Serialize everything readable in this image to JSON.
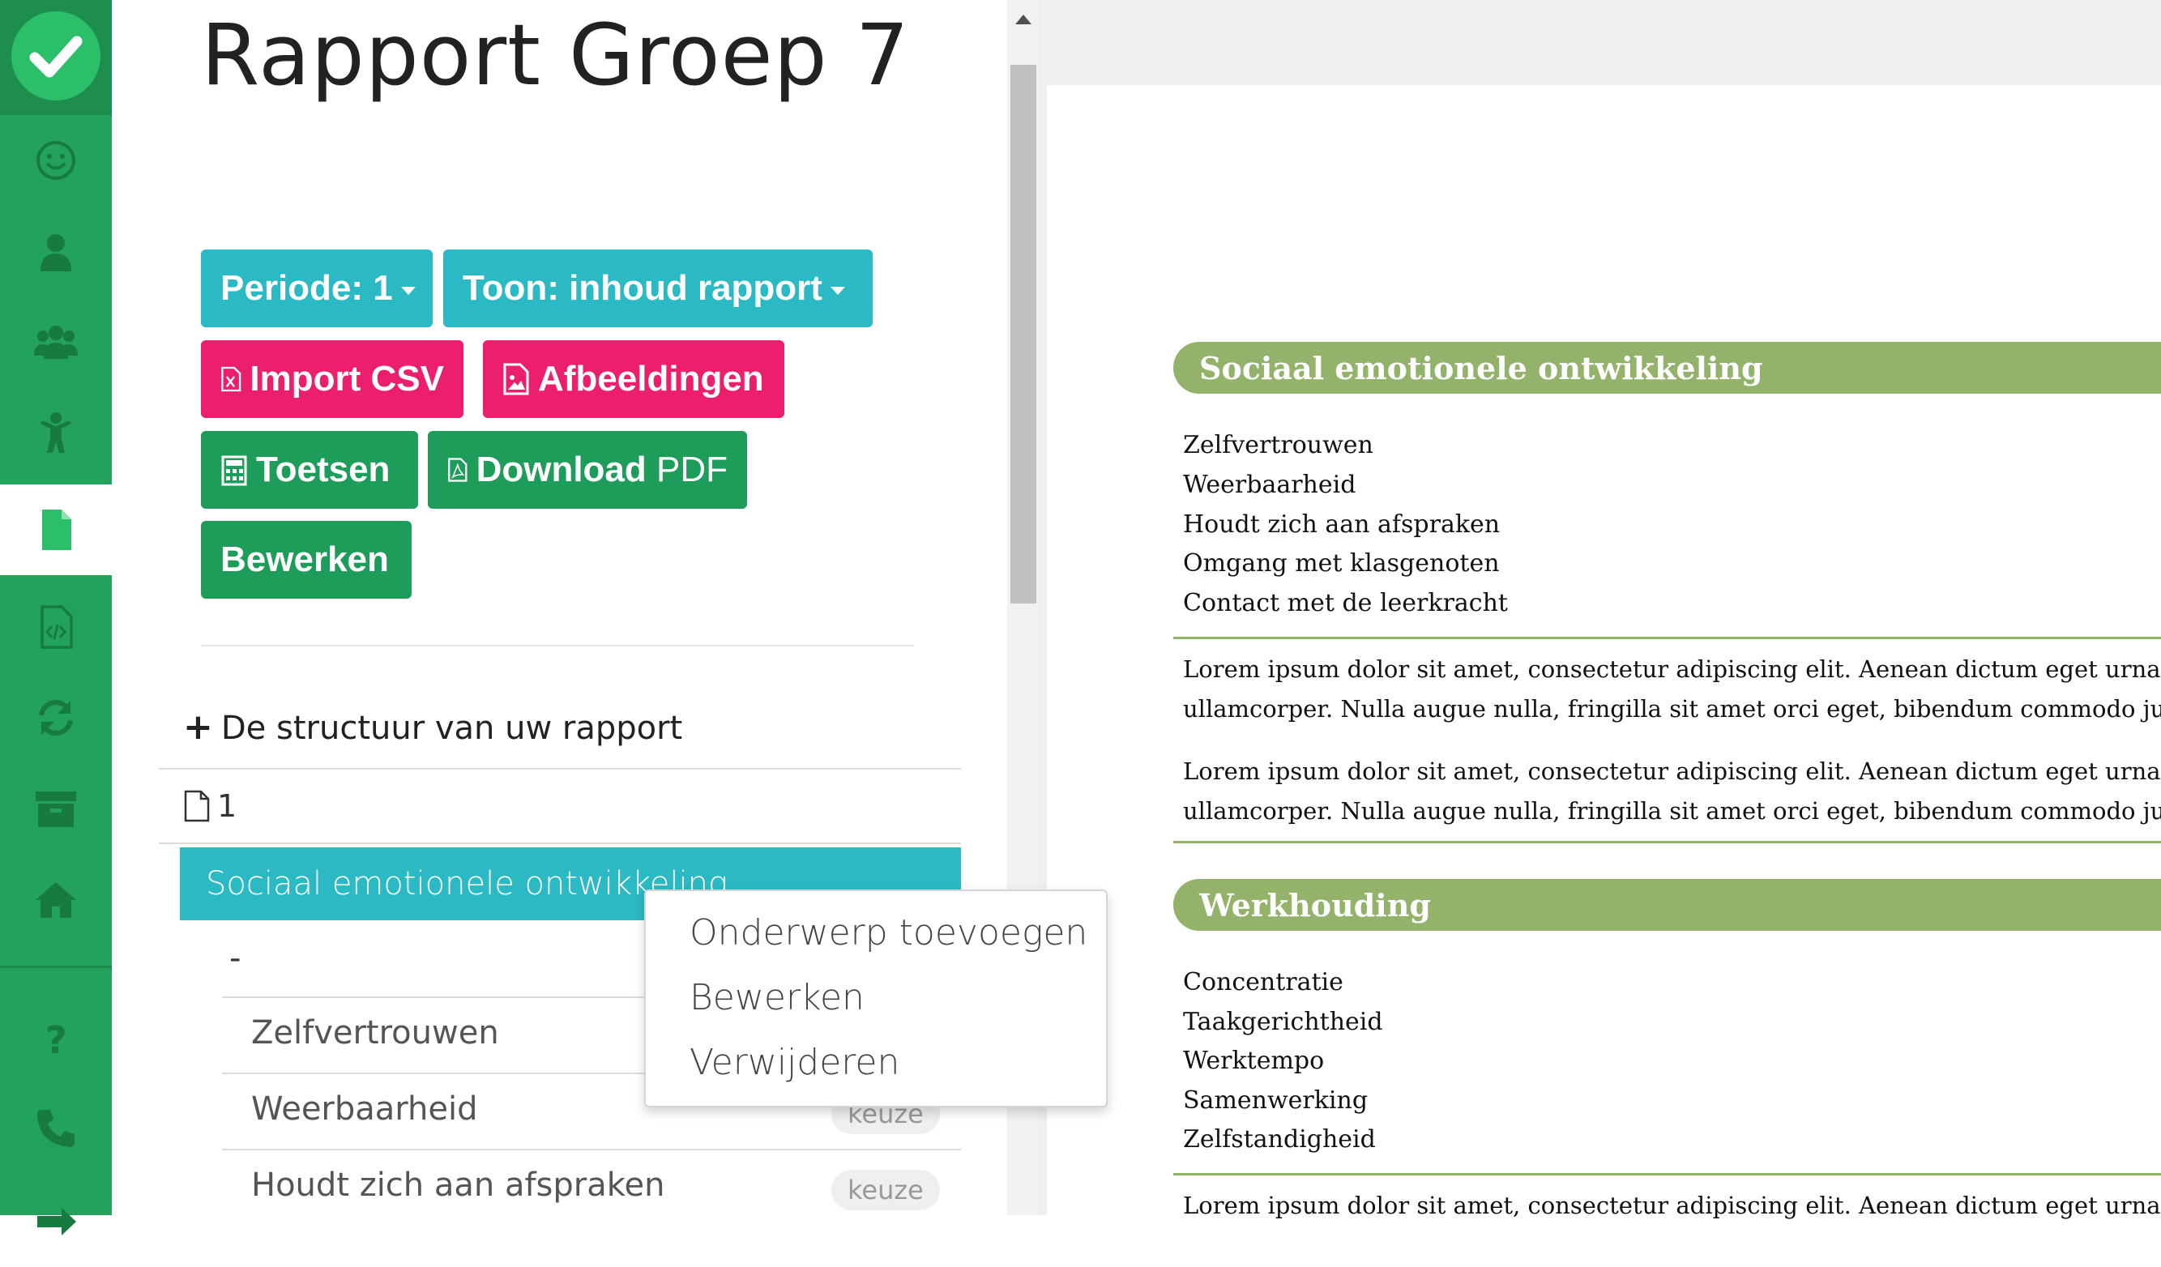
{
  "title": "Rapport Groep 7",
  "buttons": {
    "periode": "Periode: 1",
    "toon": "Toon: inhoud rapport",
    "import_csv": "Import CSV",
    "afbeeldingen": "Afbeeldingen",
    "toetsen": "Toetsen",
    "download_main": "Download",
    "download_suffix": "PDF",
    "bewerken": "Bewerken"
  },
  "structure": {
    "header": "De structuur van uw rapport",
    "page_label": "1",
    "section": "Sociaal emotionele ontwikkeling",
    "dash": "-",
    "items": [
      {
        "label": "Zelfvertrouwen",
        "badge": ""
      },
      {
        "label": "Weerbaarheid",
        "badge": "keuze"
      },
      {
        "label": "Houdt zich aan afspraken",
        "badge": "keuze"
      }
    ]
  },
  "context_menu": [
    "Onderwerp toevoegen",
    "Bewerken",
    "Verwijderen"
  ],
  "sidebar": {
    "icons": [
      "smile-icon",
      "user-icon",
      "group-icon",
      "child-icon",
      "report-icon",
      "code-file-icon",
      "refresh-icon",
      "archive-icon",
      "home-icon",
      "help-icon",
      "phone-icon",
      "logout-icon"
    ],
    "active": "report-icon"
  },
  "preview": {
    "section1": {
      "title": "Sociaal emotionele ontwikkeling",
      "items": [
        "Zelfvertrouwen",
        "Weerbaarheid",
        "Houdt zich aan afspraken",
        "Omgang met klasgenoten",
        "Contact met de leerkracht"
      ],
      "paragraphs": [
        [
          "Lorem ipsum dolor sit amet, consectetur adipiscing elit. Aenean dictum eget urna varius v",
          "ullamcorper. Nulla augue nulla, fringilla sit amet orci eget, bibendum commodo justo."
        ],
        [
          "Lorem ipsum dolor sit amet, consectetur adipiscing elit. Aenean dictum eget urna varius v",
          "ullamcorper. Nulla augue nulla, fringilla sit amet orci eget, bibendum commodo justo."
        ]
      ]
    },
    "section2": {
      "title": "Werkhouding",
      "items": [
        "Concentratie",
        "Taakgerichtheid",
        "Werktempo",
        "Samenwerking",
        "Zelfstandigheid"
      ],
      "paragraph_start": "Lorem ipsum dolor sit amet, consectetur adipiscing elit. Aenean dictum eget urna varius v"
    }
  },
  "colors": {
    "sidebar": "#22a25a",
    "teal": "#2bbac3",
    "pink": "#eb1f6d",
    "green": "#1e9c59",
    "olive": "#93b26a"
  }
}
